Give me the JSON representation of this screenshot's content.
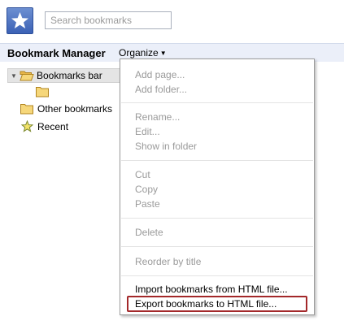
{
  "app": {
    "icon": "star-icon"
  },
  "search": {
    "placeholder": "Search bookmarks",
    "value": ""
  },
  "header": {
    "title": "Bookmark Manager",
    "organize_label": "Organize",
    "organize_caret": "▼"
  },
  "tree": {
    "items": [
      {
        "label": "Bookmarks bar",
        "icon": "folder-open-icon",
        "expanded": true,
        "selected": true
      },
      {
        "label": "",
        "icon": "folder-icon"
      },
      {
        "label": "Other bookmarks",
        "icon": "folder-icon"
      },
      {
        "label": "Recent",
        "icon": "star-icon"
      }
    ]
  },
  "menu": {
    "groups": [
      [
        {
          "label": "Add page...",
          "enabled": false
        },
        {
          "label": "Add folder...",
          "enabled": false
        }
      ],
      [
        {
          "label": "Rename...",
          "enabled": false
        },
        {
          "label": "Edit...",
          "enabled": false
        },
        {
          "label": "Show in folder",
          "enabled": false
        }
      ],
      [
        {
          "label": "Cut",
          "enabled": false
        },
        {
          "label": "Copy",
          "enabled": false
        },
        {
          "label": "Paste",
          "enabled": false
        }
      ],
      [
        {
          "label": "Delete",
          "enabled": false
        }
      ],
      [
        {
          "label": "Reorder by title",
          "enabled": false
        }
      ],
      [
        {
          "label": "Import bookmarks from HTML file...",
          "enabled": true
        },
        {
          "label": "Export bookmarks to HTML file...",
          "enabled": true,
          "highlighted": true
        }
      ]
    ]
  },
  "colors": {
    "header_bg": "#ebeff9",
    "highlight_border": "#a3282a",
    "disabled_text": "#9a9a9a"
  }
}
